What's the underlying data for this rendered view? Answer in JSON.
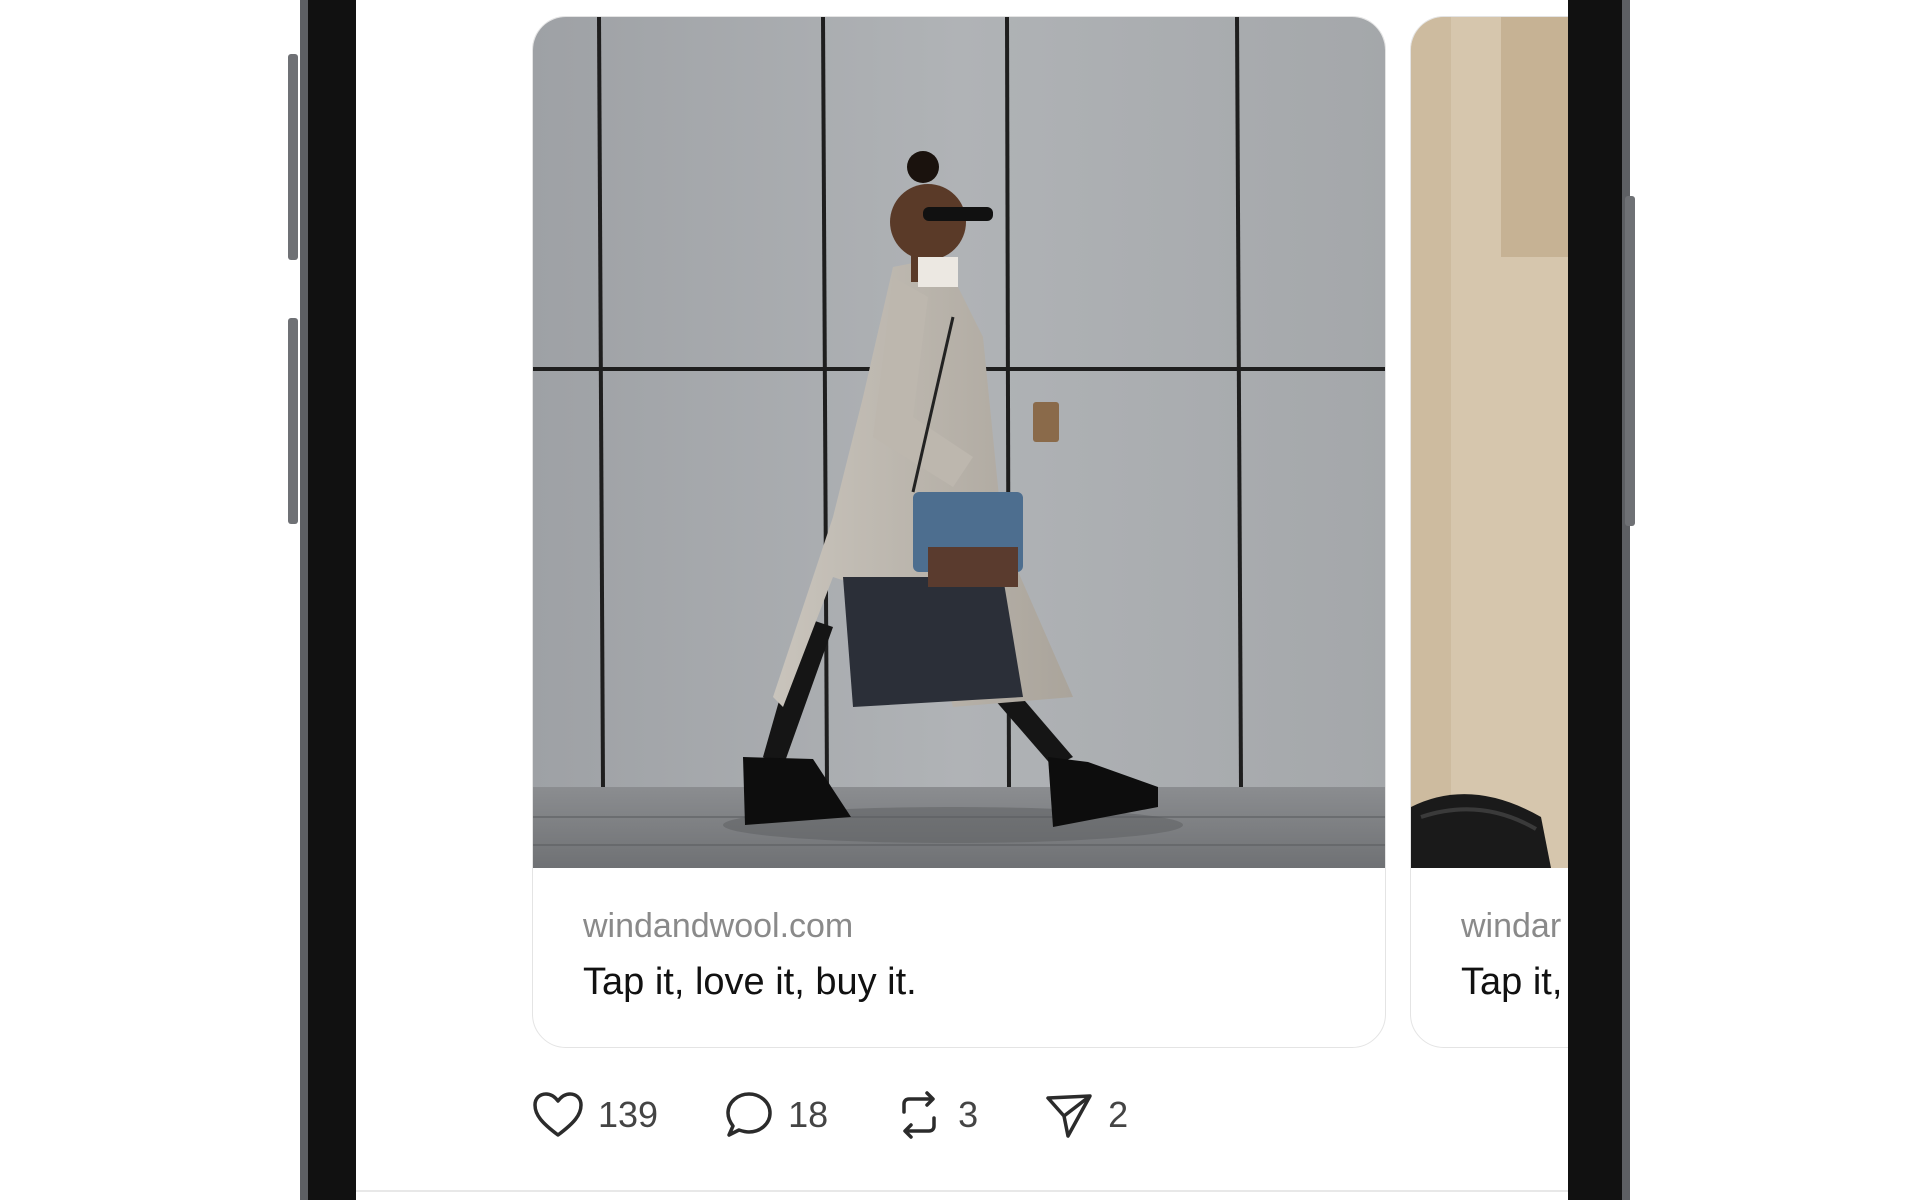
{
  "post": {
    "cards": [
      {
        "domain": "windandwool.com",
        "title": "Tap it, love it, buy it."
      },
      {
        "domain": "windar",
        "title": "Tap it,"
      }
    ],
    "actions": {
      "like": {
        "count": "139",
        "icon": "heart-icon"
      },
      "comment": {
        "count": "18",
        "icon": "speech-bubble-icon"
      },
      "repost": {
        "count": "3",
        "icon": "repost-icon"
      },
      "share": {
        "count": "2",
        "icon": "paper-plane-icon"
      }
    }
  },
  "colors": {
    "screen_background": "#ffffff",
    "phone_frame": "#111111",
    "domain_text": "#8a8a8a",
    "title_text": "#111111",
    "count_text": "#444444"
  }
}
